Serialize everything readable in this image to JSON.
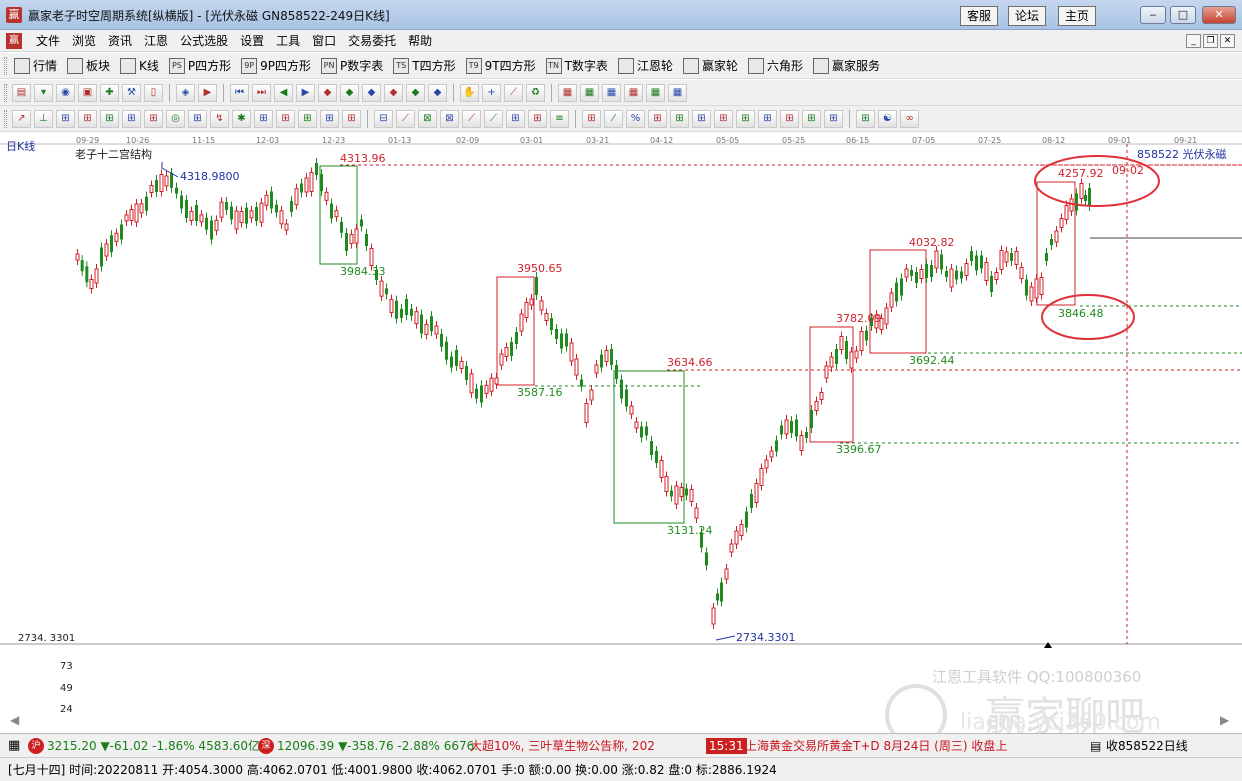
{
  "window": {
    "title": "赢家老子时空周期系统[纵横版] - [光伏永磁  GN858522-249日K线]",
    "links": [
      "客服",
      "论坛",
      "主页"
    ]
  },
  "menu": [
    "文件",
    "浏览",
    "资讯",
    "江恩",
    "公式选股",
    "设置",
    "工具",
    "窗口",
    "交易委托",
    "帮助"
  ],
  "toolbar1": [
    {
      "label": "行情",
      "icon": "quote-grid-icon"
    },
    {
      "label": "板块",
      "icon": "sector-icon"
    },
    {
      "label": "K线",
      "icon": "kline-icon"
    },
    {
      "label": "P四方形",
      "icon": "PS"
    },
    {
      "label": "9P四方形",
      "icon": "9P"
    },
    {
      "label": "P数字表",
      "icon": "PN"
    },
    {
      "label": "T四方形",
      "icon": "TS"
    },
    {
      "label": "9T四方形",
      "icon": "T9"
    },
    {
      "label": "T数字表",
      "icon": "TN"
    },
    {
      "label": "江恩轮",
      "icon": "gann-wheel-icon"
    },
    {
      "label": "赢家轮",
      "icon": "win-wheel-icon"
    },
    {
      "label": "六角形",
      "icon": "hexagon-icon"
    },
    {
      "label": "赢家服务",
      "icon": "dollar-icon"
    }
  ],
  "chart": {
    "period": "日K线",
    "indicator": "老子十二宫结构",
    "security": "858522  光伏永磁",
    "bottom_scale_label": "2734. 3301",
    "vol_ticks": [
      "73",
      "49",
      "24"
    ],
    "dates": [
      "09-29",
      "10-26",
      "11-15",
      "12-03",
      "12-23",
      "01-13",
      "02-09",
      "03-01",
      "03-21",
      "04-12",
      "05-05",
      "05-25",
      "06-15",
      "07-05",
      "07-25",
      "08-12",
      "09-01",
      "09-21"
    ],
    "annotations": {
      "high_4318": "4318.9800",
      "p4313": "4313.96",
      "p3984": "3984.33",
      "p3950": "3950.65",
      "p3587": "3587.16",
      "p3634": "3634.66",
      "p3131": "3131.24",
      "low_2734": "2734.3301",
      "p3782": "3782.09",
      "p3396": "3396.67",
      "p4032": "4032.82",
      "p3692": "3692.44",
      "p4257": "4257.92",
      "d0902": "09-02",
      "p3846": "3846.48"
    },
    "watermark_tools": "江恩工具软件  QQ:100800360",
    "watermark_brand": "赢家聊吧",
    "watermark_url": "liaoba.ycj360.com",
    "colors": {
      "up": "#d0202a",
      "down": "#1f8b1f",
      "box_green": "#1f8b1f",
      "box_red": "#d0202a",
      "circle": "#e0303a"
    }
  },
  "status1": {
    "sh_badge": "沪",
    "sh": "3215.20 ▼-61.02 -1.86% 4583.60亿",
    "sz_badge": "深",
    "sz": "12096.39 ▼-358.76 -2.88% 6676.",
    "news1": "大超10%, 三叶草生物公告称, 202",
    "time": "15:31",
    "news2": "上海黄金交易所黄金T+D 8月24日 (周三) 收盘上",
    "right": "收858522日线"
  },
  "status2": {
    "info": "[七月十四] 时间:20220811 开:4054.3000 高:4062.0701 低:4001.9800 收:4062.0701 手:0 额:0.00 换:0.00 涨:0.82 盘:0 标:2886.1924"
  }
}
